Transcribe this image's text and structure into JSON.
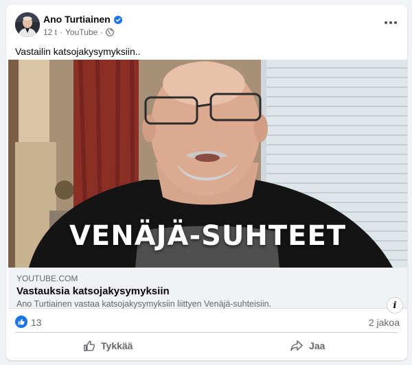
{
  "post": {
    "author": "Ano Turtiainen",
    "time": "12 t",
    "separator": "·",
    "source": "YouTube",
    "text": "Vastailin katsojakysymyksiin.."
  },
  "media": {
    "caption": "VENÄJÄ-SUHTEET",
    "info_label": "i"
  },
  "link": {
    "domain": "YOUTUBE.COM",
    "title": "Vastauksia katsojakysymyksiin",
    "description": "Ano Turtiainen vastaa katsojakysymyksiin liittyen Venäjä-suhteisiin."
  },
  "stats": {
    "likes": "13",
    "shares": "2 jakoa"
  },
  "actions": {
    "like": "Tykkää",
    "share": "Jaa"
  },
  "icons": {
    "verified": "verified-badge-icon",
    "globe": "globe-icon",
    "more": "more-options-icon",
    "like": "thumbs-up-icon",
    "share": "share-arrow-icon"
  },
  "colors": {
    "accent": "#1b74e4",
    "muted_text": "#65676b",
    "card_bg": "#ffffff",
    "page_bg": "#f0f2f5"
  }
}
